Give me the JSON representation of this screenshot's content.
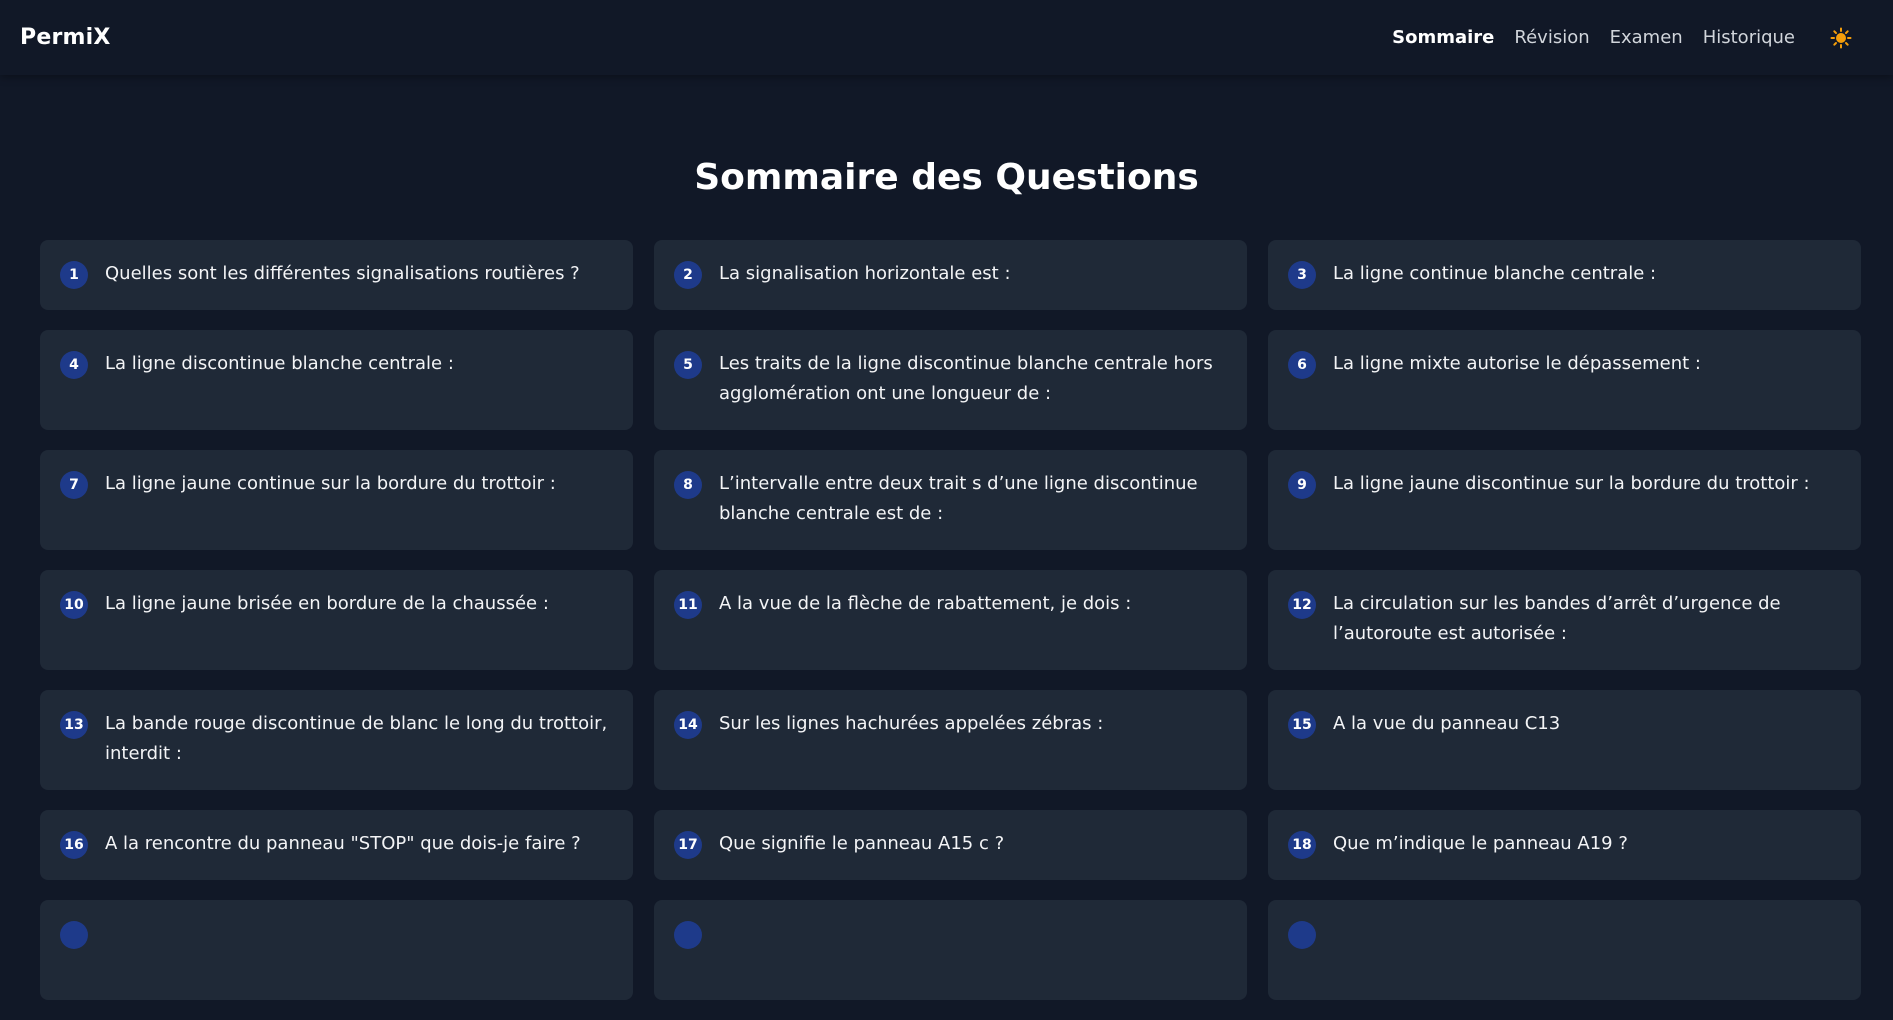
{
  "app": {
    "brand": "PermiX"
  },
  "nav": {
    "items": [
      {
        "label": "Sommaire",
        "active": true
      },
      {
        "label": "Révision",
        "active": false
      },
      {
        "label": "Examen",
        "active": false
      },
      {
        "label": "Historique",
        "active": false
      }
    ],
    "theme_icon": "sun-icon"
  },
  "main": {
    "title": "Sommaire des Questions",
    "questions": [
      {
        "n": "1",
        "text": "Quelles sont les différentes signalisations routières ?"
      },
      {
        "n": "2",
        "text": "La signalisation horizontale est :"
      },
      {
        "n": "3",
        "text": "La ligne continue blanche centrale :"
      },
      {
        "n": "4",
        "text": "La ligne discontinue blanche centrale :"
      },
      {
        "n": "5",
        "text": "Les traits de la ligne discontinue blanche centrale hors agglomération ont une longueur de :"
      },
      {
        "n": "6",
        "text": "La ligne mixte autorise le dépassement :"
      },
      {
        "n": "7",
        "text": "La ligne jaune continue sur la bordure du trottoir :"
      },
      {
        "n": "8",
        "text": "L’intervalle entre deux trait s d’une ligne discontinue blanche centrale est de :"
      },
      {
        "n": "9",
        "text": "La ligne jaune discontinue sur la bordure du trottoir :"
      },
      {
        "n": "10",
        "text": "La ligne jaune brisée en bordure de la chaussée :"
      },
      {
        "n": "11",
        "text": "A la vue de la flèche de rabattement, je dois :"
      },
      {
        "n": "12",
        "text": "La circulation sur les bandes d’arrêt d’urgence de l’autoroute est autorisée :"
      },
      {
        "n": "13",
        "text": "La bande rouge discontinue de blanc le long du trottoir, interdit :"
      },
      {
        "n": "14",
        "text": "Sur les lignes hachurées appelées zébras :"
      },
      {
        "n": "15",
        "text": "A la vue du panneau C13"
      },
      {
        "n": "16",
        "text": "A la rencontre du panneau \"STOP\" que dois-je faire ?"
      },
      {
        "n": "17",
        "text": "Que signifie le panneau A15 c ?"
      },
      {
        "n": "18",
        "text": "Que m’indique le panneau A19 ?"
      }
    ]
  },
  "colors": {
    "background": "#111827",
    "card": "#1f2937",
    "badge": "#1e3a8a",
    "sun": "#f59e0b"
  }
}
